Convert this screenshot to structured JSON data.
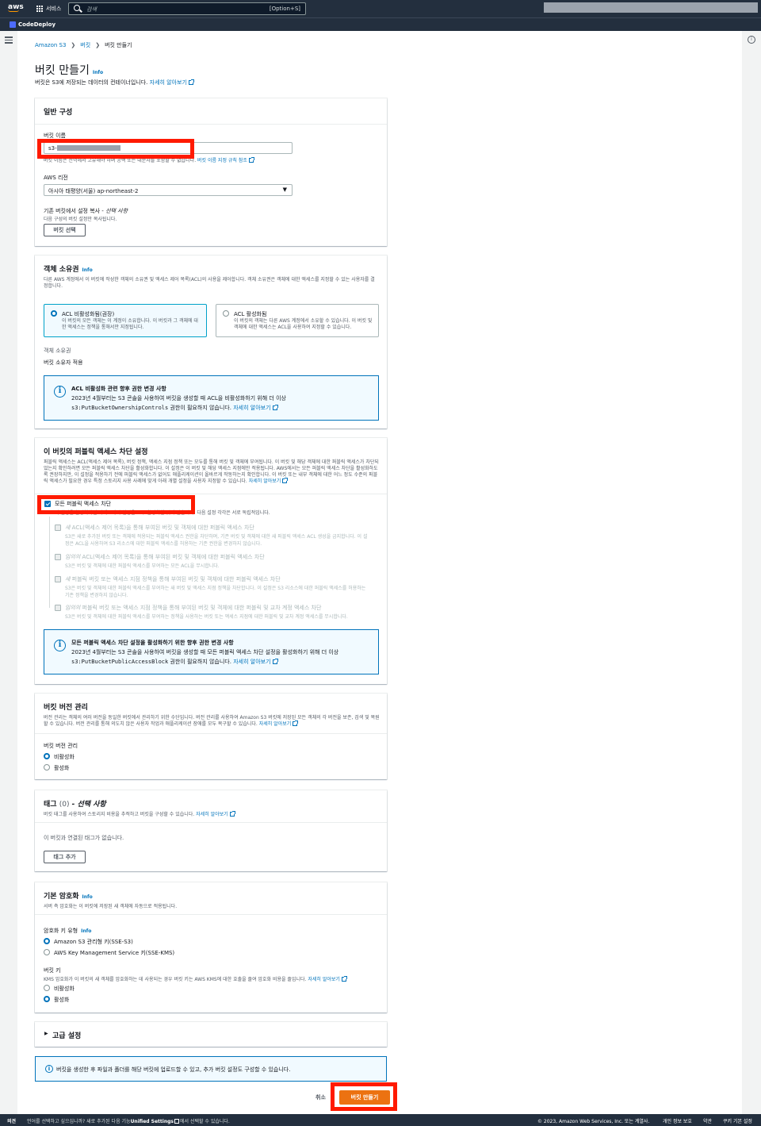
{
  "topnav": {
    "logo": "aws",
    "services": "서비스",
    "search_placeholder": "검색",
    "search_shortcut": "[Option+S]",
    "service_name": "CodeDeploy"
  },
  "breadcrumb": [
    "Amazon S3",
    "버킷",
    "버킷 만들기"
  ],
  "page": {
    "title": "버킷 만들기",
    "info": "Info",
    "desc": "버킷은 S3에 저장되는 데이터의 컨테이너입니다.",
    "learn_more": "자세히 알아보기"
  },
  "general": {
    "title": "일반 구성",
    "bucket_name_label": "버킷 이름",
    "bucket_name_value": "s3-",
    "bucket_name_hint": "버킷 이름은 전역에서 고유해야 하며 공백 또는 대문자를 포함할 수 없습니다.",
    "bucket_name_rules": "버킷 이름 지정 규칙 참조",
    "region_label": "AWS 리전",
    "region_value": "아시아 태평양(서울) ap-northeast-2",
    "copy_label": "기존 버킷에서 설정 복사 - ",
    "copy_optional": "선택 사항",
    "copy_desc": "다음 구성의 버킷 설정만 복사됩니다.",
    "choose_bucket": "버킷 선택"
  },
  "ownership": {
    "title": "객체 소유권",
    "info": "Info",
    "desc": "다른 AWS 계정에서 이 버킷에 작성한 객체의 소유권 및 액세스 제어 목록(ACL)의 사용을 제어합니다. 객체 소유권은 객체에 대한 액세스를 지정할 수 있는 사용자를 결정합니다.",
    "opt1_title": "ACL 비활성화됨(권장)",
    "opt1_desc": "이 버킷의 모든 객체는 이 계정이 소유합니다. 이 버킷과 그 객체에 대한 액세스는 정책을 통해서만 지정됩니다.",
    "opt2_title": "ACL 활성화됨",
    "opt2_desc": "이 버킷의 객체는 다른 AWS 계정에서 소유할 수 있습니다. 이 버킷 및 객체에 대한 액세스는 ACL을 사용하여 지정할 수 있습니다.",
    "owner_label": "객체 소유권",
    "owner_value": "버킷 소유자 적용",
    "alert_title": "ACL 비활성화 관련 향후 권한 변경 사항",
    "alert_line1": "2023년 4월부터는 S3 콘솔을 사용하여 버킷을 생성할 때 ACL을 비활성화하기 위해 더 이상",
    "alert_code": "s3:PutBucketOwnershipControls",
    "alert_line2": " 권한이 필요하지 않습니다.",
    "alert_link": "자세히 알아보기"
  },
  "public_access": {
    "title": "이 버킷의 퍼블릭 액세스 차단 설정",
    "desc": "퍼블릭 액세스는 ACL(액세스 제어 목록), 버킷 정책, 액세스 지점 정책 또는 모두를 통해 버킷 및 객체에 부여됩니다. 이 버킷 및 해당 객체에 대한 퍼블릭 액세스가 차단되었는지 확인하려면 모든 퍼블릭 액세스 차단을 활성화합니다. 이 설정은 이 버킷 및 해당 액세스 지점에만 적용됩니다. AWS에서는 모든 퍼블릭 액세스 차단을 활성화하도록 권장하지만, 이 설정을 적용하기 전에 퍼블릭 액세스가 없어도 애플리케이션이 올바르게 작동하는지 확인합니다. 이 버킷 또는 내부 객체에 대한 어느 정도 수준의 퍼블릭 액세스가 필요한 경우 특정 스토리지 사용 사례에 맞게 아래 개별 설정을 사용자 지정할 수 있습니다.",
    "learn_more": "자세히 알아보기",
    "block_all": "모든 퍼블릭 액세스 차단",
    "block_all_desc": "이 설정을 활성화하면 아래 4개의 설정을 모두 활성화한 것과 같습니다. 다음 설정 각각은 서로 독립적입니다.",
    "items": [
      {
        "prefix": "새",
        "title": " ACL(액세스 제어 목록)을 통해 부여된 버킷 및 객체에 대한 퍼블릭 액세스 차단",
        "desc1": "S3은 새로 추가된 버킷 또는 객체에 적용되는 퍼블릭 액세스 권한을 차단하며, 기존 버킷 및 객체에 대한 새 퍼블릭 액세스 ACL 생성을 금지합니다. 이 설",
        "desc2": "정은 ACL을 사용하여 S3 리소스에 대한 퍼블릭 액세스를 허용하는 기존 권한을 변경하지 않습니다."
      },
      {
        "prefix": "임의의",
        "title": " ACL(액세스 제어 목록)을 통해 부여된 버킷 및 객체에 대한 퍼블릭 액세스 차단",
        "desc1": "S3은 버킷 및 객체에 대한 퍼블릭 액세스를 부여하는 모든 ACL을 무시합니다.",
        "desc2": ""
      },
      {
        "prefix": "새",
        "title": " 퍼블릭 버킷 또는 액세스 지점 정책을 통해 부여된 버킷 및 객체에 대한 퍼블릭 액세스 차단",
        "desc1": "S3은 버킷 및 객체에 대한 퍼블릭 액세스를 부여하는 새 버킷 및 액세스 지점 정책을 차단합니다. 이 설정은 S3 리소스에 대한 퍼블릭 액세스를 허용하는",
        "desc2": "기존 정책을 변경하지 않습니다."
      },
      {
        "prefix": "임의의",
        "title": " 퍼블릭 버킷 또는 액세스 지점 정책을 통해 부여된 버킷 및 객체에 대한 퍼블릭 및 교차 계정 액세스 차단",
        "desc1": "S3은 버킷 및 객체에 대한 퍼블릭 액세스를 부여하는 정책을 사용하는 버킷 또는 액세스 지점에 대한 퍼블릭 및 교차 계정 액세스를 무시합니다.",
        "desc2": ""
      }
    ],
    "alert_title": "모든 퍼블릭 액세스 차단 설정을 활성화하기 위한 향후 권한 변경 사항",
    "alert_line1": "2023년 4월부터는 S3 콘솔을 사용하여 버킷을 생성할 때 모든 퍼블릭 액세스 차단 설정을 활성화하기 위해 더 이상",
    "alert_code": "s3:PutBucketPublicAccessBlock",
    "alert_line2": " 권한이 필요하지 않습니다.",
    "alert_link": "자세히 알아보기"
  },
  "versioning": {
    "title": "버킷 버전 관리",
    "desc": "버전 관리는 객체의 여러 버전을 동일한 버킷에서 관리하기 위한 수단입니다. 버전 관리를 사용하여 Amazon S3 버킷에 저장된 모든 객체의 각 버전을 보존, 검색 및 복원할 수 있습니다. 버전 관리를 통해 의도치 않은 사용자 작업과 애플리케이션 장애를 모두 복구할 수 있습니다.",
    "learn_more": "자세히 알아보기",
    "label": "버킷 버전 관리",
    "opt_disable": "비활성화",
    "opt_enable": "활성화"
  },
  "tags": {
    "title": "태그",
    "count": "(0)",
    "optional": " - 선택 사항",
    "desc": "버킷 태그를 사용하여 스토리지 비용을 추적하고 버킷을 구성할 수 있습니다.",
    "learn_more": "자세히 알아보기",
    "empty": "이 버킷과 연결된 태그가 없습니다.",
    "add": "태그 추가"
  },
  "encryption": {
    "title": "기본 암호화",
    "info": "Info",
    "desc": "서버 측 암호화는 이 버킷에 저장된 새 객체에 자동으로 적용됩니다.",
    "key_type_label": "암호화 키 유형",
    "key_type_info": "Info",
    "opt_s3": "Amazon S3 관리형 키(SSE-S3)",
    "opt_kms": "AWS Key Management Service 키(SSE-KMS)",
    "bucket_key_label": "버킷 키",
    "bucket_key_desc": "KMS 암호화가 이 버킷의 새 객체를 암호화하는 데 사용되는 경우 버킷 키는 AWS KMS에 대한 호출을 줄여 암호화 비용을 줄입니다.",
    "learn_more": "자세히 알아보기",
    "opt_disable": "비활성화",
    "opt_enable": "활성화"
  },
  "advanced": {
    "title": "고급 설정"
  },
  "notice": "버킷을 생성한 후 파일과 폴더를 해당 버킷에 업로드할 수 있고, 추가 버킷 설정도 구성할 수 있습니다.",
  "actions": {
    "cancel": "취소",
    "create": "버킷 만들기"
  },
  "footer": {
    "feedback": "의견",
    "lang_prompt": "언어를 선택하고 싶으십니까? 새로 추가된 다음 기능",
    "unified": "Unified Settings",
    "lang_suffix": "에서 선택할 수 있습니다.",
    "copyright": "© 2023, Amazon Web Services, Inc. 또는 계열사.",
    "privacy": "개인 정보 보호",
    "terms": "약관",
    "cookies": "쿠키 기본 설정"
  },
  "colors": {
    "accent": "#0073bb",
    "primary_button": "#ec7211",
    "highlight": "#ff1a00",
    "nav_bg": "#232f3e"
  }
}
